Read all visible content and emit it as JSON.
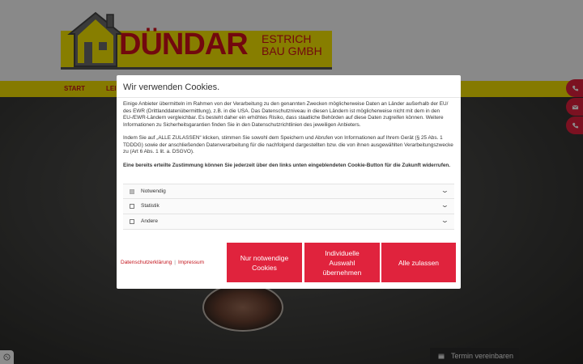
{
  "logo": {
    "main": "DÜNDAR",
    "line1": "ESTRICH",
    "line2": "BAU GMBH"
  },
  "nav": {
    "start": "START",
    "item2": "LEI"
  },
  "termin_label": "Termin vereinbaren",
  "side_icons": [
    "phone-icon",
    "mail-icon",
    "phone-icon"
  ],
  "colors": {
    "brand_red": "#d0101a",
    "button_red": "#e0233d",
    "brand_yellow": "#f3df00"
  },
  "dialog": {
    "title": "Wir verwenden Cookies.",
    "paragraph1": "Einige Anbieter übermitteln im Rahmen von der Verarbeitung zu den genannten Zwecken möglicherweise Daten an Länder außerhalb der EU/ des EWR (Drittlanddatenübermittlung), z.B. in die USA. Das Datenschutzniveau in diesen Ländern ist möglicherweise nicht mit dem in den EU-/EWR-Ländern vergleichbar. Es besteht daher ein erhöhtes Risiko, dass staatliche Behörden auf diese Daten zugreifen können. Weitere Informationen zu Sicherheitsgarantien finden Sie in den Datenschutzrichtlinien des jeweiligen Anbieters.",
    "paragraph2": "Indem Sie auf „ALLE ZULASSEN“ klicken, stimmen Sie sowohl dem Speichern und Abrufen von Informationen auf Ihrem Gerät (§ 25 Abs. 1 TDDDG) sowie der anschließenden Datenverarbeitung für die nachfolgend dargestellten bzw. die von ihnen ausgewählten Verarbeitungszwecke zu (Art 6 Abs. 1 lit. a. DSGVO).",
    "paragraph3": "Eine bereits erteilte Zustimmung können Sie jederzeit über den links unten eingeblendeten Cookie-Button für die Zukunft widerrufen.",
    "categories": [
      {
        "label": "Notwendig",
        "checked": true
      },
      {
        "label": "Statistik",
        "checked": false
      },
      {
        "label": "Andere",
        "checked": false
      }
    ],
    "links": {
      "privacy": "Datenschutzerklärung",
      "separator": "|",
      "imprint": "Impressum"
    },
    "buttons": {
      "necessary": "Nur notwendige Cookies",
      "individual": "Individuelle Auswahl übernehmen",
      "accept_all": "Alle zulassen"
    }
  }
}
